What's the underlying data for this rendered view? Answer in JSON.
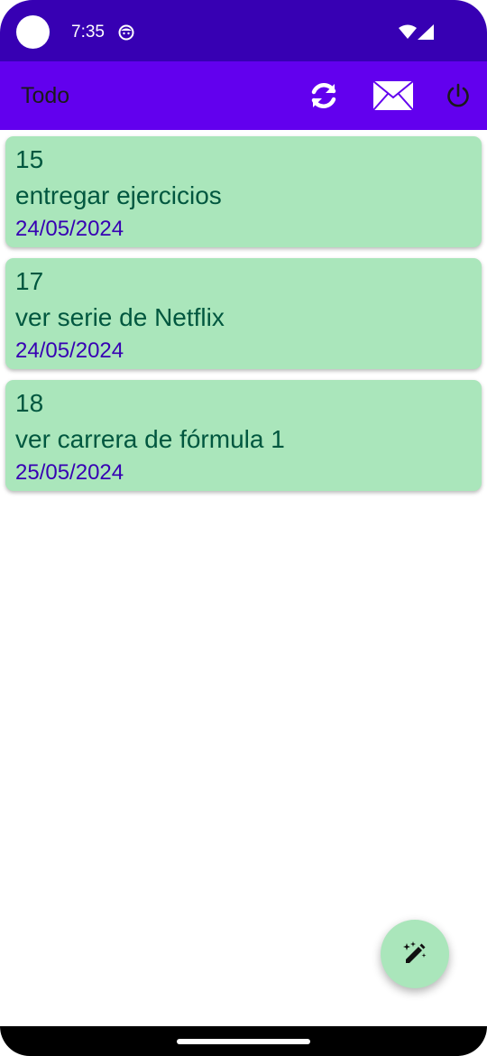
{
  "status_bar": {
    "time": "7:35",
    "icons": [
      "camera-dot",
      "app-notification-icon",
      "wifi-icon",
      "signal-icon"
    ]
  },
  "app_bar": {
    "title": "Todo",
    "color": "#6200ee",
    "actions": [
      "refresh-icon",
      "mail-icon",
      "power-icon"
    ]
  },
  "tasks": [
    {
      "id": "15",
      "title": "entregar ejercicios",
      "date": "24/05/2024"
    },
    {
      "id": "17",
      "title": "ver serie de Netflix",
      "date": "24/05/2024"
    },
    {
      "id": "18",
      "title": "ver carrera de fórmula 1",
      "date": "25/05/2024"
    }
  ],
  "colors": {
    "status_bar": "#3700b3",
    "card_background": "#aae6bb",
    "card_text": "#00573f",
    "card_date": "#3700b3"
  },
  "fab": {
    "icon": "magic-pencil-icon"
  }
}
